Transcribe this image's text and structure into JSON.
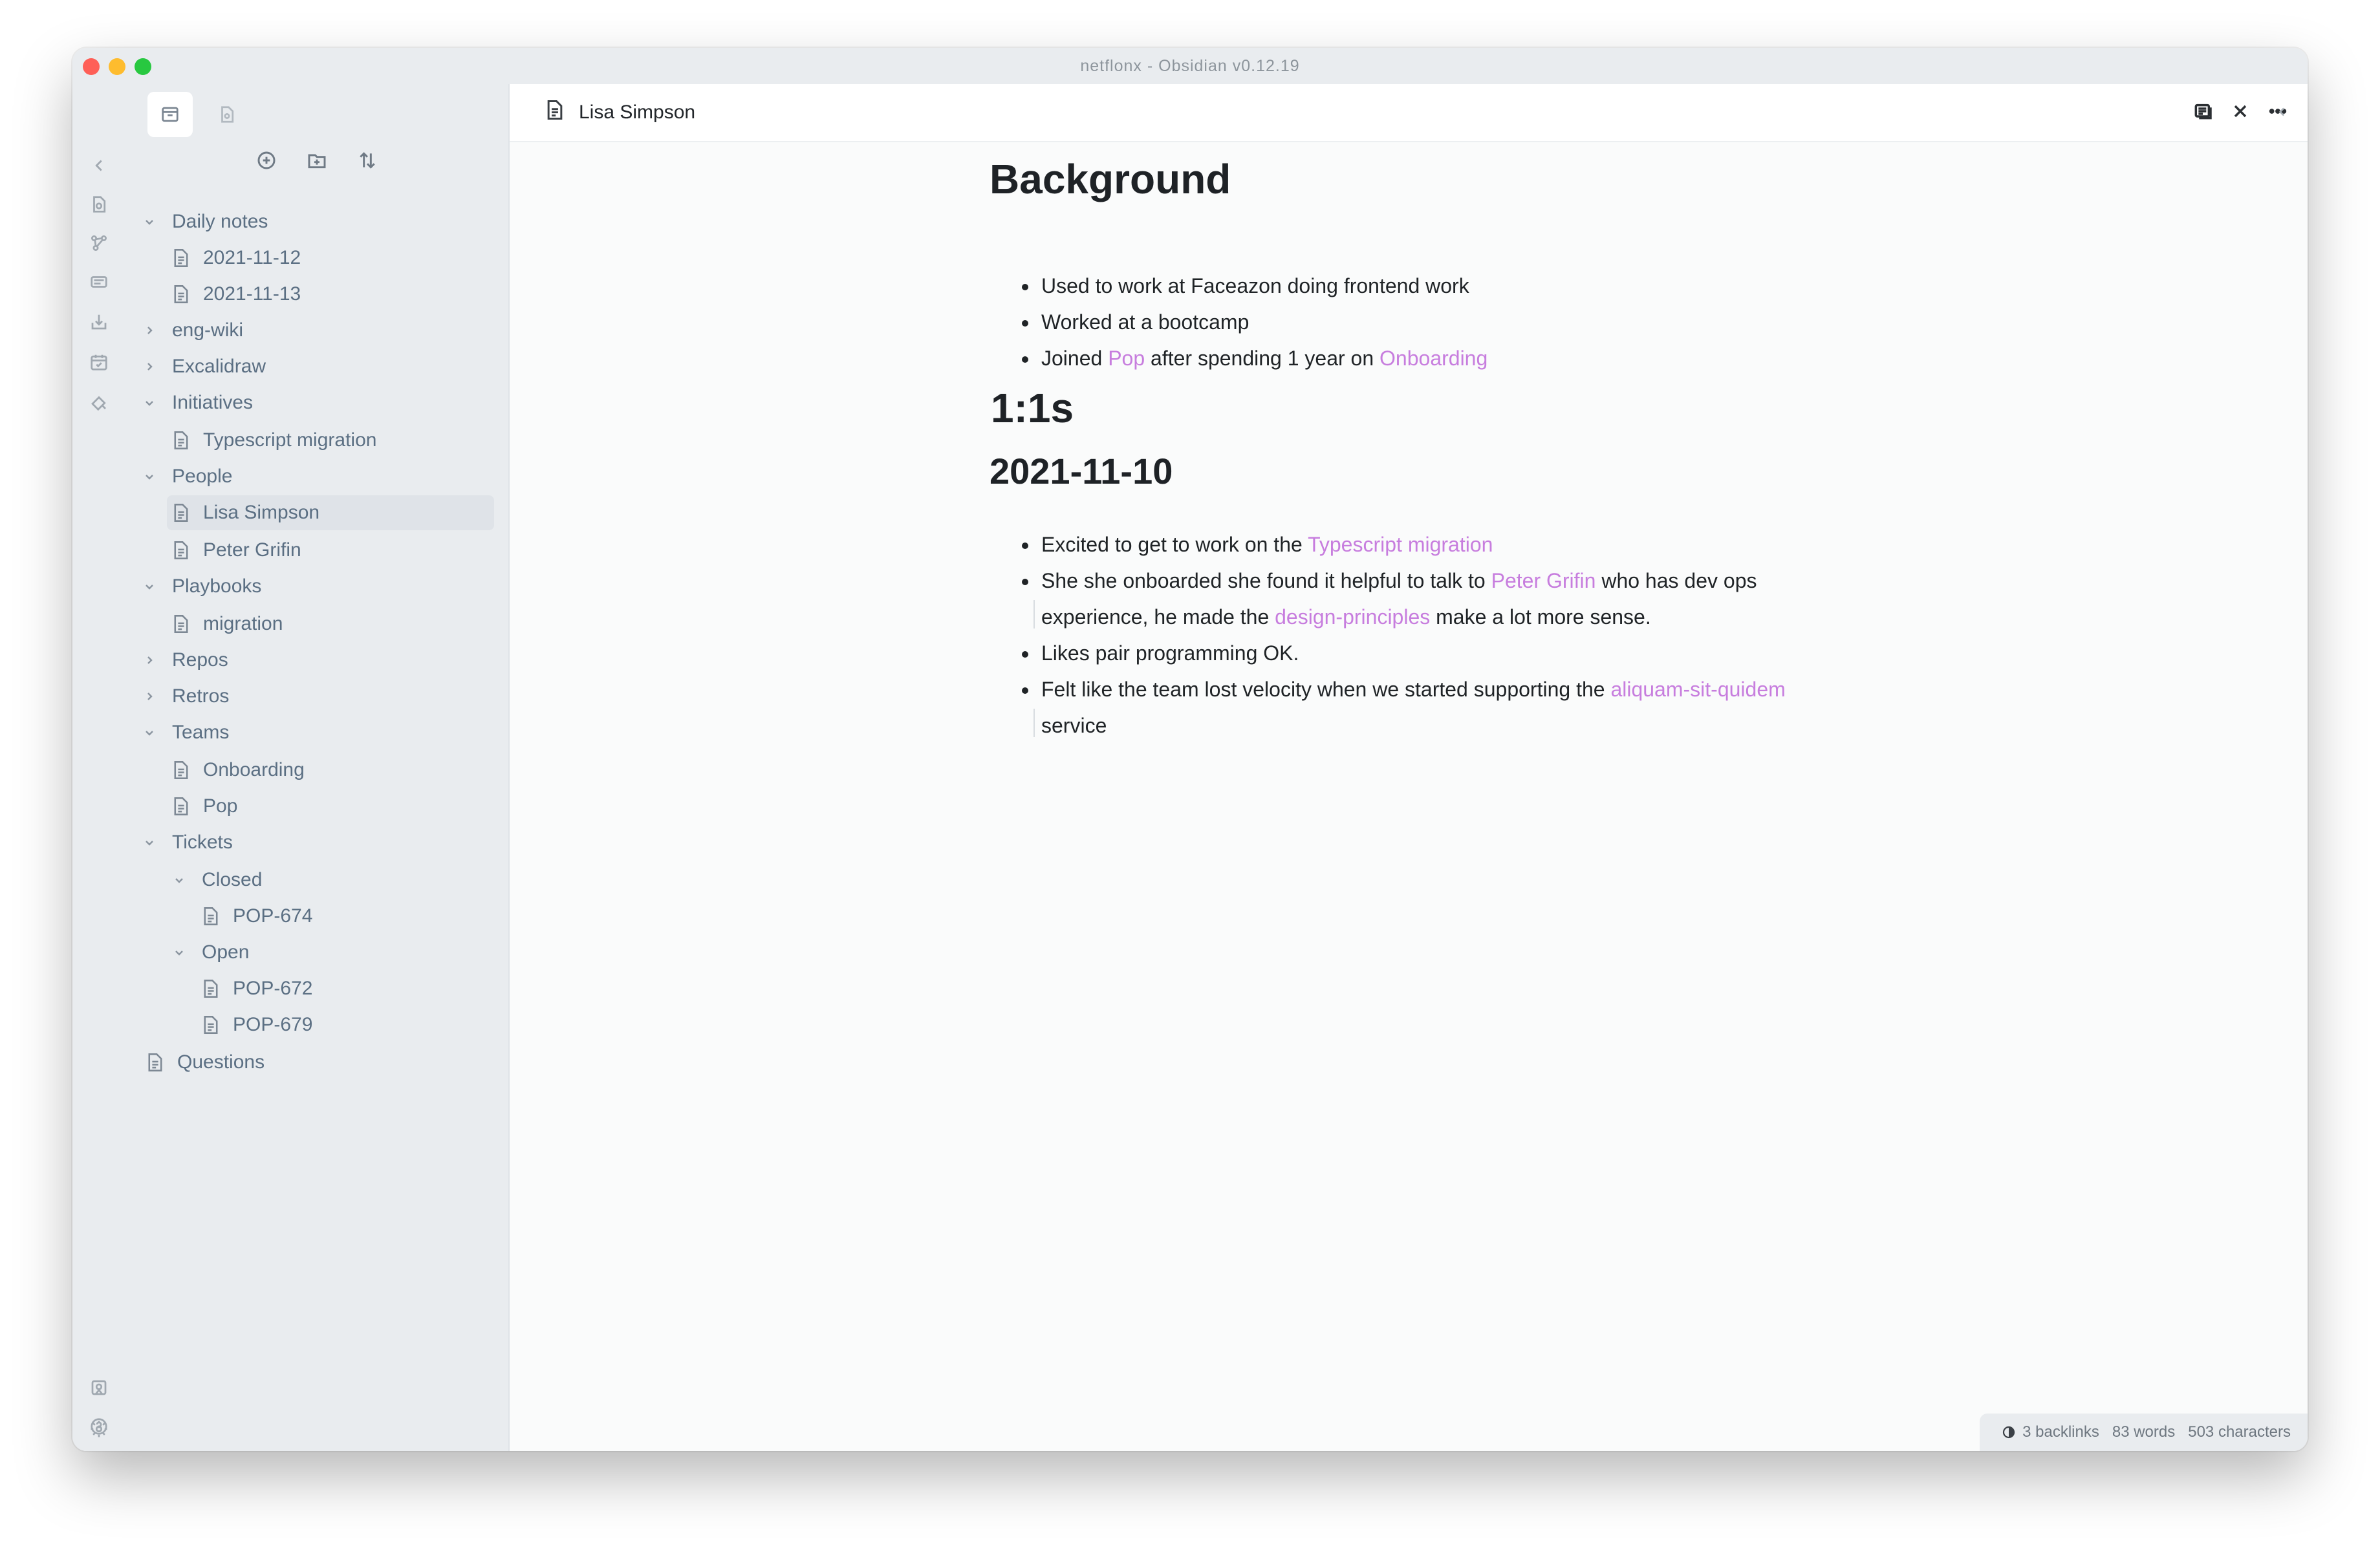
{
  "window": {
    "title": "netflonx - Obsidian v0.12.19"
  },
  "ribbon": {
    "icons": [
      "collapse-left-icon",
      "open-quick-switcher-icon",
      "graph-view-icon",
      "slides-icon",
      "import-icon",
      "daily-note-icon",
      "canvas-icon",
      "vault-switch-icon",
      "help-icon",
      "settings-icon"
    ]
  },
  "sidebar": {
    "tabs": [
      "file-explorer-icon",
      "search-file-icon"
    ],
    "actions": [
      "new-note-icon",
      "new-folder-icon",
      "sort-icon"
    ],
    "tree": [
      {
        "label": "Daily notes",
        "type": "folder",
        "open": true,
        "depth": 0
      },
      {
        "label": "2021-11-12",
        "type": "file",
        "depth": 1
      },
      {
        "label": "2021-11-13",
        "type": "file",
        "depth": 1
      },
      {
        "label": "eng-wiki",
        "type": "folder",
        "open": false,
        "depth": 0
      },
      {
        "label": "Excalidraw",
        "type": "folder",
        "open": false,
        "depth": 0
      },
      {
        "label": "Initiatives",
        "type": "folder",
        "open": true,
        "depth": 0
      },
      {
        "label": "Typescript migration",
        "type": "file",
        "depth": 1
      },
      {
        "label": "People",
        "type": "folder",
        "open": true,
        "depth": 0
      },
      {
        "label": "Lisa Simpson",
        "type": "file",
        "depth": 1,
        "active": true
      },
      {
        "label": "Peter Grifin",
        "type": "file",
        "depth": 1
      },
      {
        "label": "Playbooks",
        "type": "folder",
        "open": true,
        "depth": 0
      },
      {
        "label": "migration",
        "type": "file",
        "depth": 1
      },
      {
        "label": "Repos",
        "type": "folder",
        "open": false,
        "depth": 0
      },
      {
        "label": "Retros",
        "type": "folder",
        "open": false,
        "depth": 0
      },
      {
        "label": "Teams",
        "type": "folder",
        "open": true,
        "depth": 0
      },
      {
        "label": "Onboarding",
        "type": "file",
        "depth": 1
      },
      {
        "label": "Pop",
        "type": "file",
        "depth": 1
      },
      {
        "label": "Tickets",
        "type": "folder",
        "open": true,
        "depth": 0
      },
      {
        "label": "Closed",
        "type": "folder",
        "open": true,
        "depth": 1
      },
      {
        "label": "POP-674",
        "type": "file",
        "depth": 2
      },
      {
        "label": "Open",
        "type": "folder",
        "open": true,
        "depth": 1
      },
      {
        "label": "POP-672",
        "type": "file",
        "depth": 2
      },
      {
        "label": "POP-679",
        "type": "file",
        "depth": 2
      },
      {
        "label": "Questions",
        "type": "file",
        "depth": 0
      }
    ]
  },
  "tab": {
    "title": "Lisa Simpson"
  },
  "doc": {
    "h_background": "Background",
    "bg_1": "Used to work at Faceazon doing frontend work",
    "bg_2": "Worked at a bootcamp",
    "bg_3_a": "Joined ",
    "bg_3_link1": "Pop",
    "bg_3_b": " after spending 1 year on ",
    "bg_3_link2": "Onboarding",
    "h_1on1": "1:1s",
    "h_date": "2021-11-10",
    "n1_a": "Excited to get to work on the ",
    "n1_link": "Typescript migration",
    "n2_a": "She she onboarded she found it helpful to talk to ",
    "n2_link1": "Peter Grifin",
    "n2_b": " who has dev ops",
    "n2_c": "experience, he made the ",
    "n2_link2": "design-principles",
    "n2_d": " make a lot more sense.",
    "n3": "Likes pair programming OK.",
    "n4_a": "Felt like the team lost velocity when we started supporting the ",
    "n4_link": "aliquam-sit-quidem",
    "n4_b": "service"
  },
  "status": {
    "backlinks": "3 backlinks",
    "words": "83 words",
    "characters": "503 characters"
  },
  "colors": {
    "link": "#c77dde",
    "sidebar_bg": "#e9ecef",
    "text": "#1f2326"
  }
}
